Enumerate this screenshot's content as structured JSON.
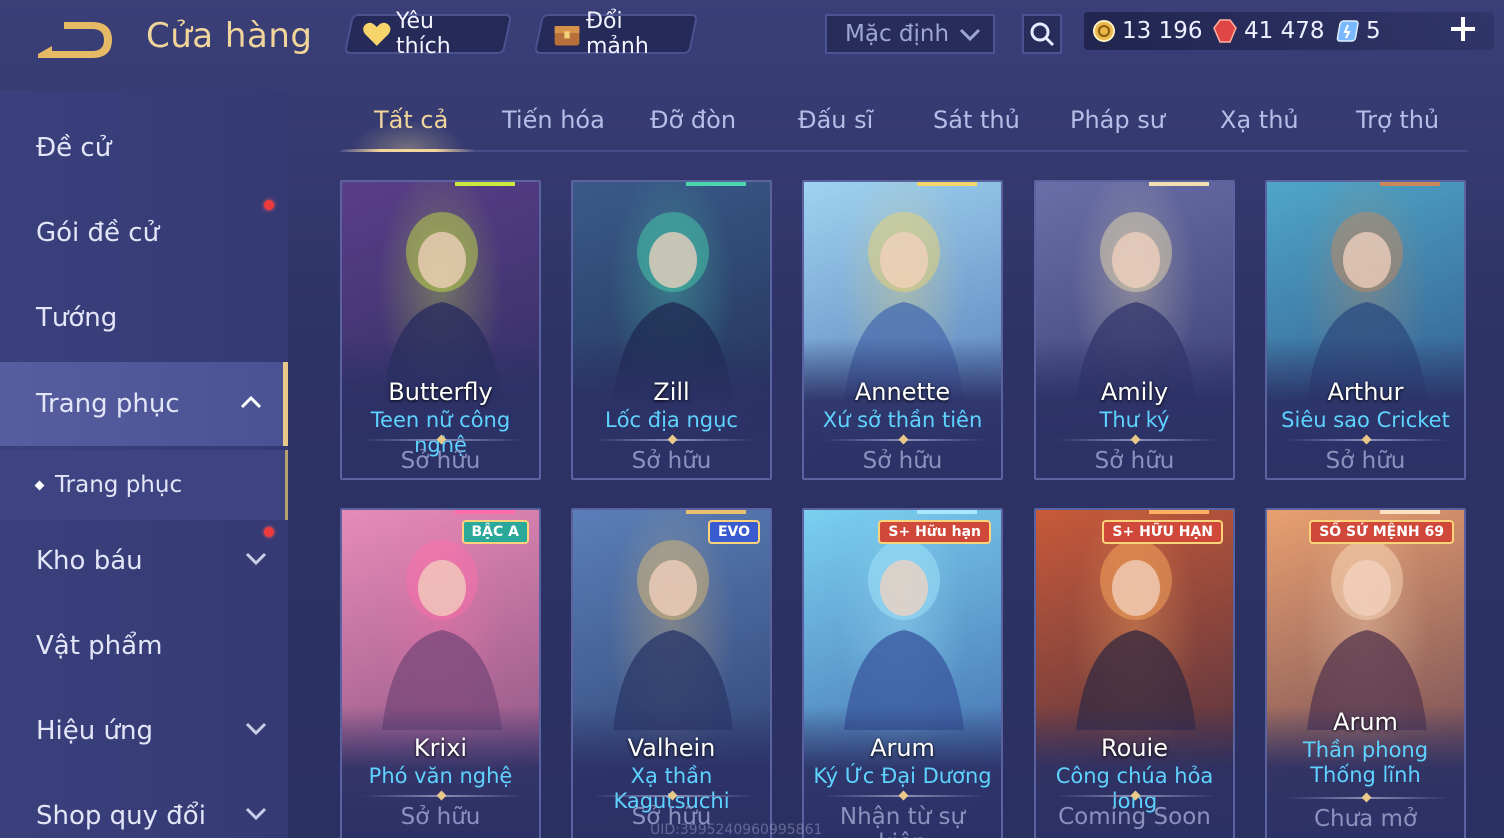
{
  "header": {
    "title": "Cửa hàng",
    "favorites_label": "Yêu thích",
    "exchange_label": "Đổi mảnh",
    "sort_value": "Mặc định",
    "currencies": [
      {
        "name": "gold",
        "value": "13 196",
        "color": "#e8b84a"
      },
      {
        "name": "ruby",
        "value": "41 478",
        "color": "#e04646"
      },
      {
        "name": "voucher",
        "value": "5",
        "color": "#7ab8ff"
      }
    ]
  },
  "sidebar": {
    "items": [
      {
        "label": "Đề cử"
      },
      {
        "label": "Gói đề cử"
      },
      {
        "label": "Tướng"
      },
      {
        "label": "Trang phục"
      },
      {
        "label": "Trang phục"
      },
      {
        "label": "Kho báu"
      },
      {
        "label": "Vật phẩm"
      },
      {
        "label": "Hiệu ứng"
      },
      {
        "label": "Shop quy đổi"
      }
    ]
  },
  "tabs": [
    {
      "label": "Tất cả"
    },
    {
      "label": "Tiến hóa"
    },
    {
      "label": "Đỡ đòn"
    },
    {
      "label": "Đấu sĩ"
    },
    {
      "label": "Sát thủ"
    },
    {
      "label": "Pháp sư"
    },
    {
      "label": "Xạ thủ"
    },
    {
      "label": "Trợ thủ"
    }
  ],
  "cards": [
    {
      "hero": "Butterfly",
      "skin": "Teen nữ công nghệ",
      "status": "Sở hữu",
      "badge": "",
      "art_from": "#5a3e88",
      "art_to": "#2a2d5e",
      "accent": "#c9e840"
    },
    {
      "hero": "Zill",
      "skin": "Lốc địa ngục",
      "status": "Sở hữu",
      "badge": "",
      "art_from": "#3b5a8a",
      "art_to": "#1f2c52",
      "accent": "#4ad7b0"
    },
    {
      "hero": "Annette",
      "skin": "Xứ sở thần tiên",
      "status": "Sở hữu",
      "badge": "",
      "art_from": "#9fd3f0",
      "art_to": "#4a6fb0",
      "accent": "#f5d56a"
    },
    {
      "hero": "Amily",
      "skin": "Thư ký",
      "status": "Sở hữu",
      "badge": "",
      "art_from": "#6a6fa8",
      "art_to": "#34386e",
      "accent": "#f0e2b0"
    },
    {
      "hero": "Arthur",
      "skin": "Siêu sao Cricket",
      "status": "Sở hữu",
      "badge": "",
      "art_from": "#4fa6c8",
      "art_to": "#2d4d82",
      "accent": "#c98a5a"
    },
    {
      "hero": "Krixi",
      "skin": "Phó văn nghệ",
      "status": "Sở hữu",
      "badge": "BẬC A",
      "art_from": "#e88bb8",
      "art_to": "#7a4a7a",
      "accent": "#ff6ea8"
    },
    {
      "hero": "Valhein",
      "skin": "Xạ thần Kagutsuchi",
      "status": "Sở hữu",
      "badge": "EVO",
      "art_from": "#5a7fb8",
      "art_to": "#2b3a6a",
      "accent": "#e8c070"
    },
    {
      "hero": "Arum",
      "skin": "Ký Ức Đại Dương",
      "status": "Nhận từ sự kiện",
      "badge": "S+ Hữu hạn",
      "art_from": "#7ad0f0",
      "art_to": "#3a5aa0",
      "accent": "#a8e8ff"
    },
    {
      "hero": "Rouie",
      "skin": "Công chúa hỏa long",
      "status": "Coming Soon",
      "badge": "S+ HỮU HẠN",
      "art_from": "#c85a3a",
      "art_to": "#3a2a40",
      "accent": "#ffb060"
    },
    {
      "hero": "Arum",
      "skin": "Thần phong Thống lĩnh",
      "status": "Chưa mở",
      "badge": "SỐ SỨ MỆNH 69",
      "art_from": "#e8a070",
      "art_to": "#5a3a50",
      "accent": "#ffe0c0"
    }
  ],
  "uid": "UID:3995240960995861"
}
